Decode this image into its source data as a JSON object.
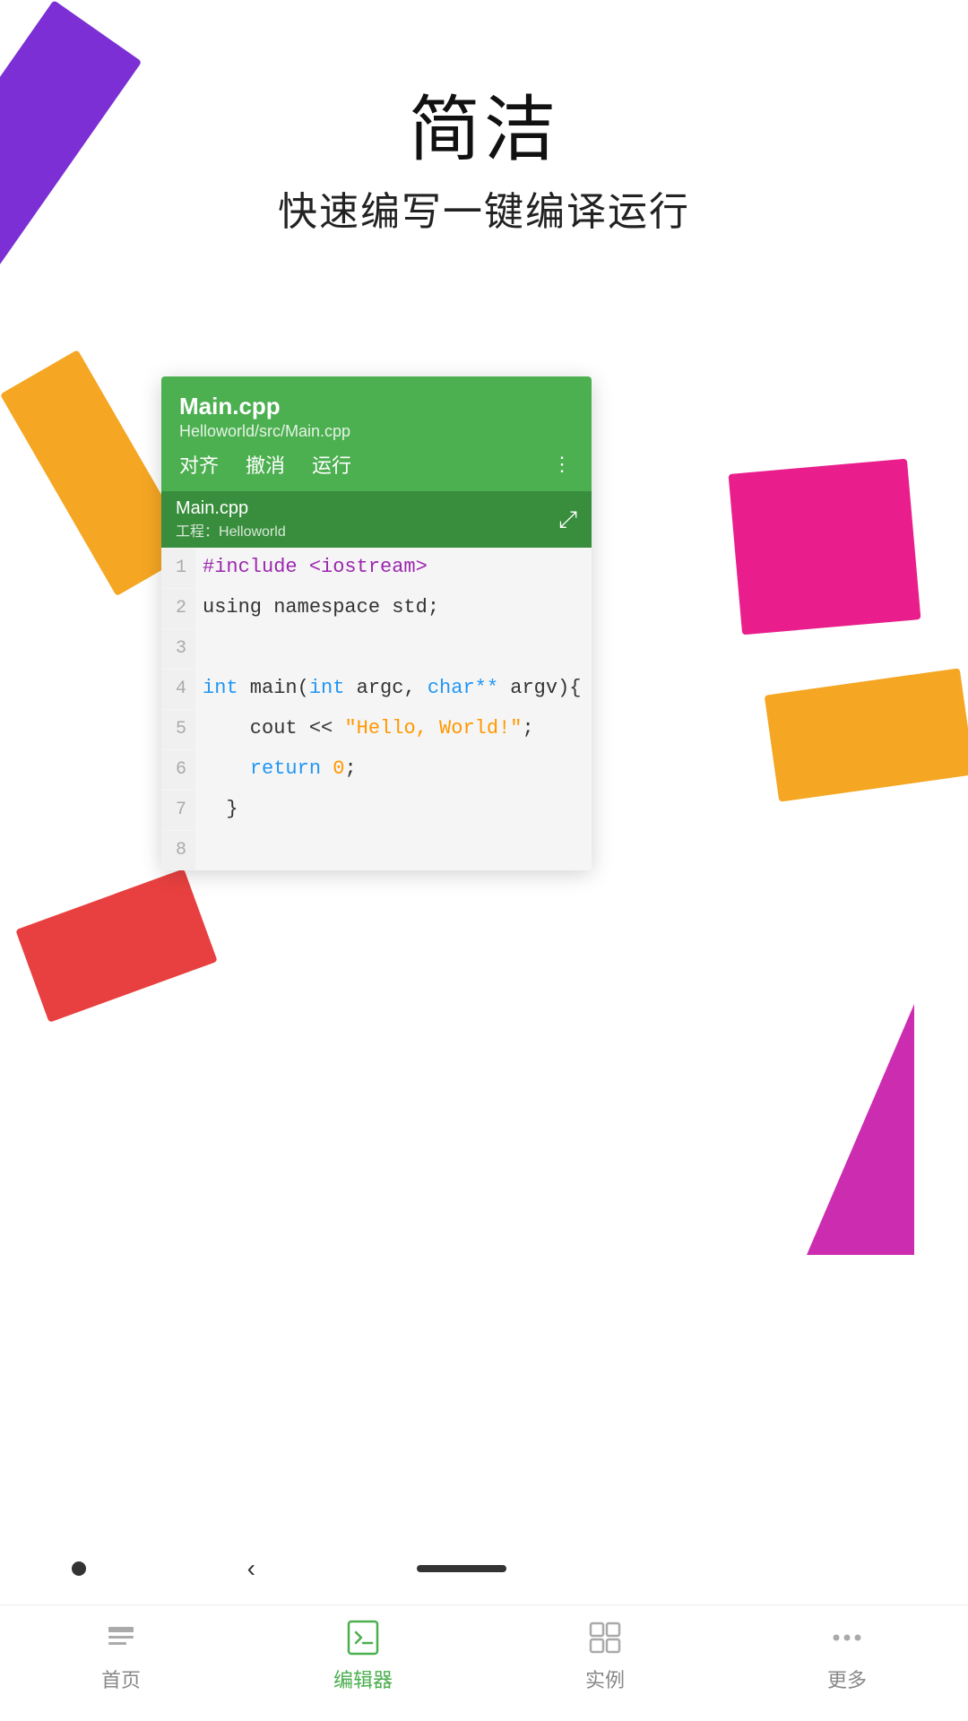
{
  "title": "简洁",
  "subtitle": "快速编写一键编译运行",
  "editor": {
    "file_name": "Main.cpp",
    "file_path": "Helloworld/src/Main.cpp",
    "tab_file": "Main.cpp",
    "tab_project_label": "工程：",
    "tab_project": "Helloworld",
    "actions": {
      "align": "对齐",
      "undo": "撤消",
      "run": "运行"
    },
    "code_lines": [
      {
        "num": "1",
        "html": "#include <iostream>"
      },
      {
        "num": "2",
        "html": "using namespace std;"
      },
      {
        "num": "3",
        "html": ""
      },
      {
        "num": "4",
        "html": "int main(int argc, char** argv){"
      },
      {
        "num": "5",
        "html": "    cout << \"Hello, World!\";"
      },
      {
        "num": "6",
        "html": "    return 0;"
      },
      {
        "num": "7",
        "html": "  }"
      },
      {
        "num": "8",
        "html": ""
      }
    ]
  },
  "nav": {
    "items": [
      {
        "id": "home",
        "label": "首页",
        "active": false
      },
      {
        "id": "editor",
        "label": "编辑器",
        "active": true
      },
      {
        "id": "examples",
        "label": "实例",
        "active": false
      },
      {
        "id": "more",
        "label": "更多",
        "active": false
      }
    ]
  },
  "colors": {
    "green": "#4caf50",
    "green_dark": "#388e3c",
    "purple": "#7b2fd4",
    "pink": "#e91e8c",
    "orange": "#f5a623",
    "red": "#e84040",
    "magenta": "#cc2db0"
  }
}
